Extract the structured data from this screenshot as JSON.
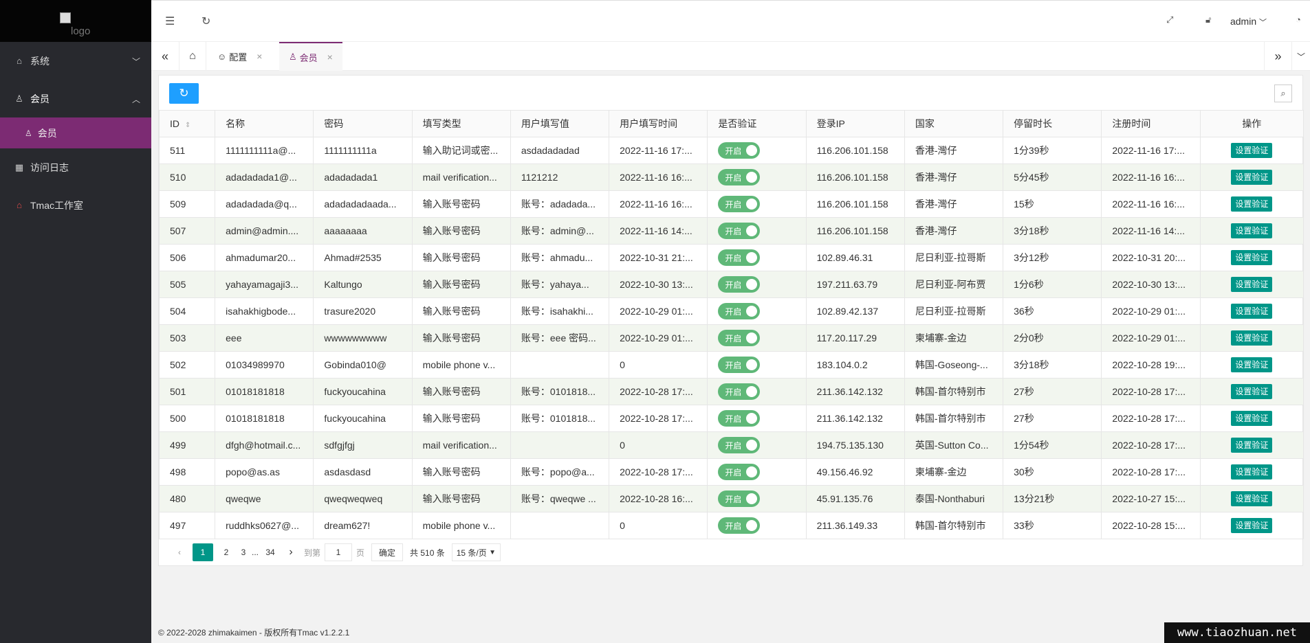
{
  "logo": {
    "alt": "logo"
  },
  "sidebar": {
    "items": [
      {
        "label": "系统",
        "icon": "home-icon"
      },
      {
        "label": "会员",
        "icon": "users-icon"
      },
      {
        "label": "访问日志",
        "icon": "log-icon"
      },
      {
        "label": "Tmac工作室",
        "icon": "house-icon"
      }
    ],
    "sub_item": {
      "label": "会员",
      "icon": "user-icon"
    }
  },
  "topbar": {
    "user": "admin"
  },
  "tabs": [
    {
      "label": "配置",
      "icon": "smile-icon"
    },
    {
      "label": "会员",
      "icon": "user-icon"
    }
  ],
  "table": {
    "headers": [
      "ID",
      "名称",
      "密码",
      "填写类型",
      "用户填写值",
      "用户填写时间",
      "是否验证",
      "登录IP",
      "国家",
      "停留时长",
      "注册时间",
      "操作"
    ],
    "switch_label": "开启",
    "action_label": "设置验证",
    "rows": [
      [
        "511",
        "1111111111a@...",
        "1111111111a",
        "输入助记词或密...",
        "asdadadadad",
        "2022-11-16 17:...",
        "116.206.101.158",
        "香港-灣仔",
        "1分39秒",
        "2022-11-16 17:..."
      ],
      [
        "510",
        "adadadada1@...",
        "adadadada1",
        "mail verification...",
        "1121212",
        "2022-11-16 16:...",
        "116.206.101.158",
        "香港-灣仔",
        "5分45秒",
        "2022-11-16 16:..."
      ],
      [
        "509",
        "adadadada@q...",
        "adadadadaada...",
        "输入账号密码",
        "账号：adadada...",
        "2022-11-16 16:...",
        "116.206.101.158",
        "香港-灣仔",
        "15秒",
        "2022-11-16 16:..."
      ],
      [
        "507",
        "admin@admin....",
        "aaaaaaaa",
        "输入账号密码",
        "账号：admin@...",
        "2022-11-16 14:...",
        "116.206.101.158",
        "香港-灣仔",
        "3分18秒",
        "2022-11-16 14:..."
      ],
      [
        "506",
        "ahmadumar20...",
        "Ahmad#2535",
        "输入账号密码",
        "账号：ahmadu...",
        "2022-10-31 21:...",
        "102.89.46.31",
        "尼日利亚-拉哥斯",
        "3分12秒",
        "2022-10-31 20:..."
      ],
      [
        "505",
        "yahayamagaji3...",
        "Kaltungo",
        "输入账号密码",
        "账号：yahaya...",
        "2022-10-30 13:...",
        "197.211.63.79",
        "尼日利亚-阿布贾",
        "1分6秒",
        "2022-10-30 13:..."
      ],
      [
        "504",
        "isahakhigbode...",
        "trasure2020",
        "输入账号密码",
        "账号：isahakhi...",
        "2022-10-29 01:...",
        "102.89.42.137",
        "尼日利亚-拉哥斯",
        "36秒",
        "2022-10-29 01:..."
      ],
      [
        "503",
        "eee",
        "wwwwwwwww",
        "输入账号密码",
        "账号：eee 密码...",
        "2022-10-29 01:...",
        "117.20.117.29",
        "柬埔寨-金边",
        "2分0秒",
        "2022-10-29 01:..."
      ],
      [
        "502",
        "01034989970",
        "Gobinda010@",
        "mobile phone v...",
        "",
        "0",
        "183.104.0.2",
        "韩国-Goseong-...",
        "3分18秒",
        "2022-10-28 19:..."
      ],
      [
        "501",
        "01018181818",
        "fuckyoucahina",
        "输入账号密码",
        "账号：0101818...",
        "2022-10-28 17:...",
        "211.36.142.132",
        "韩国-首尔特别市",
        "27秒",
        "2022-10-28 17:..."
      ],
      [
        "500",
        "01018181818",
        "fuckyoucahina",
        "输入账号密码",
        "账号：0101818...",
        "2022-10-28 17:...",
        "211.36.142.132",
        "韩国-首尔特别市",
        "27秒",
        "2022-10-28 17:..."
      ],
      [
        "499",
        "dfgh@hotmail.c...",
        "sdfgjfgj",
        "mail verification...",
        "",
        "0",
        "194.75.135.130",
        "英国-Sutton Co...",
        "1分54秒",
        "2022-10-28 17:..."
      ],
      [
        "498",
        "popo@as.as",
        "asdasdasd",
        "输入账号密码",
        "账号：popo@a...",
        "2022-10-28 17:...",
        "49.156.46.92",
        "柬埔寨-金边",
        "30秒",
        "2022-10-28 17:..."
      ],
      [
        "480",
        "qweqwe",
        "qweqweqweq",
        "输入账号密码",
        "账号：qweqwe ...",
        "2022-10-28 16:...",
        "45.91.135.76",
        "泰国-Nonthaburi",
        "13分21秒",
        "2022-10-27 15:..."
      ],
      [
        "497",
        "ruddhks0627@...",
        "dream627!",
        "mobile phone v...",
        "",
        "0",
        "211.36.149.33",
        "韩国-首尔特别市",
        "33秒",
        "2022-10-28 15:..."
      ]
    ]
  },
  "pager": {
    "pages": [
      "1",
      "2",
      "3",
      "...",
      "34"
    ],
    "goto": "到第",
    "page_value": "1",
    "page_unit": "页",
    "confirm": "确定",
    "total": "共 510 条",
    "per_page": "15 条/页"
  },
  "footer": {
    "text": "© 2022-2028 zhimakaimen - 版权所有Tmac v1.2.2.1"
  },
  "watermark": "www.tiaozhuan.net",
  "colors": {
    "accent": "#7c2b73",
    "primary": "#009688",
    "switch": "#5fb878",
    "blue": "#1e9fff"
  }
}
